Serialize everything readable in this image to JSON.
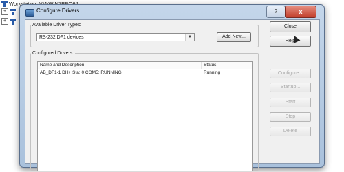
{
  "background": {
    "tree_item_label": "Workstation, VM-WIN7PRO64",
    "expanders": [
      "+",
      "+"
    ]
  },
  "dialog": {
    "title": "Configure Drivers",
    "help_caption_glyph": "?",
    "close_caption_glyph": "x",
    "available_types_label": "Available Driver Types:",
    "selected_driver_type": "RS-232 DF1 devices",
    "add_new_label": "Add New...",
    "configured_label": "Configured Drivers:",
    "columns": [
      "Name and Description",
      "Status"
    ],
    "rows": [
      {
        "name": "AB_DF1-1 DH+ Sta: 0 COM5: RUNNING",
        "status": "Running"
      }
    ],
    "buttons": {
      "close": "Close",
      "help": "Help",
      "configure": "Configure...",
      "startup": "Startup...",
      "start": "Start",
      "stop": "Stop",
      "delete": "Delete"
    }
  }
}
